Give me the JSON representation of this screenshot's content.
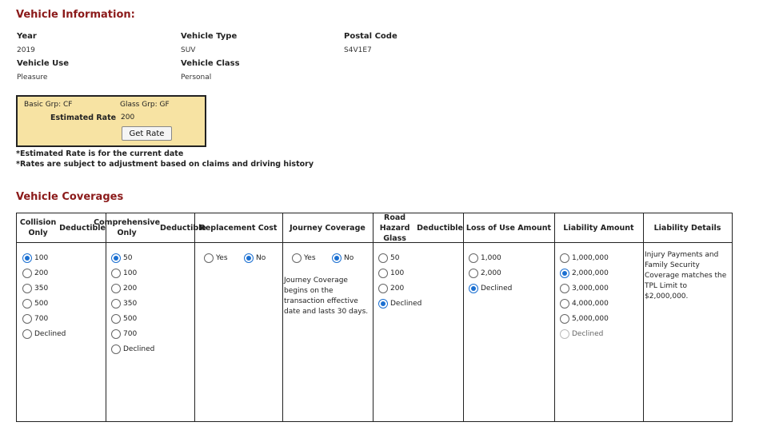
{
  "vehicle_info": {
    "title": "Vehicle Information:",
    "fields": [
      {
        "label": "Year",
        "value": "2019"
      },
      {
        "label": "Vehicle Type",
        "value": "SUV"
      },
      {
        "label": "Postal Code",
        "value": "S4V1E7"
      },
      {
        "label": "Vehicle Use",
        "value": "Pleasure"
      },
      {
        "label": "Vehicle Class",
        "value": "Personal"
      }
    ]
  },
  "rate_box": {
    "basic_grp": "Basic Grp: CF",
    "glass_grp": "Glass Grp: GF",
    "estimated_rate_label": "Estimated Rate",
    "estimated_rate_value": "200",
    "get_rate_button": "Get Rate"
  },
  "notes": [
    "*Estimated Rate is for the current date",
    "*Rates are subject to adjustment based on claims and driving history"
  ],
  "coverages": {
    "title": "Vehicle Coverages",
    "columns": [
      {
        "header": [
          "Collision Only",
          "Deductible"
        ],
        "options": [
          {
            "label": "100",
            "selected": true
          },
          {
            "label": "200"
          },
          {
            "label": "350"
          },
          {
            "label": "500"
          },
          {
            "label": "700"
          },
          {
            "label": "Declined"
          }
        ]
      },
      {
        "header": [
          "Comprehensive Only",
          "Deductible"
        ],
        "options": [
          {
            "label": "50",
            "selected": true
          },
          {
            "label": "100"
          },
          {
            "label": "200"
          },
          {
            "label": "350"
          },
          {
            "label": "500"
          },
          {
            "label": "700"
          },
          {
            "label": "Declined"
          }
        ]
      },
      {
        "header": [
          "Replacement Cost"
        ],
        "options": [
          {
            "label": "Yes"
          },
          {
            "label": "No",
            "selected": true
          }
        ]
      },
      {
        "header": [
          "Journey Coverage"
        ],
        "options": [
          {
            "label": "Yes"
          },
          {
            "label": "No",
            "selected": true
          }
        ],
        "description": [
          "Journey Coverage",
          "begins on the",
          "transaction effective",
          "date and lasts 30 days."
        ]
      },
      {
        "header": [
          "Road Hazard Glass",
          "Deductible"
        ],
        "options": [
          {
            "label": "50"
          },
          {
            "label": "100"
          },
          {
            "label": "200"
          },
          {
            "label": "Declined",
            "selected": true
          }
        ]
      },
      {
        "header": [
          "Loss of Use Amount"
        ],
        "options": [
          {
            "label": "1,000"
          },
          {
            "label": "2,000"
          },
          {
            "label": "Declined",
            "selected": true
          }
        ]
      },
      {
        "header": [
          "Liability Amount"
        ],
        "options": [
          {
            "label": "1,000,000"
          },
          {
            "label": "2,000,000",
            "selected": true
          },
          {
            "label": "3,000,000"
          },
          {
            "label": "4,000,000"
          },
          {
            "label": "5,000,000"
          },
          {
            "label": "Declined",
            "disabled": true
          }
        ]
      },
      {
        "header": [
          "Liability Details"
        ],
        "description": [
          "Injury Payments and",
          "Family Security",
          "Coverage matches the",
          "TPL Limit to",
          "$2,000,000."
        ]
      }
    ]
  },
  "colors": {
    "title": "#8b1a1a",
    "rate_box_bg": "#f7e3a3",
    "radio_selected": "#1a6fd1"
  }
}
